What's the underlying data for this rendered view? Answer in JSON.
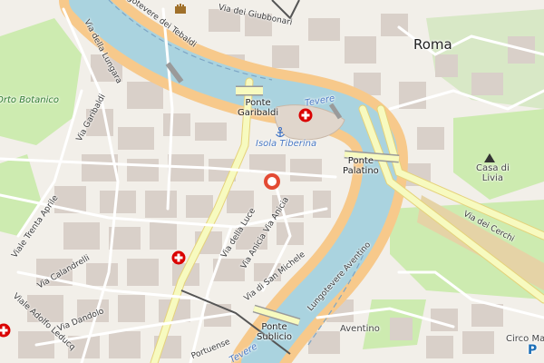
{
  "map": {
    "labels": {
      "city": "Roma",
      "river": "Tevere",
      "river_top": "Lungotevere dei Tebaldi",
      "giubbonari": "Via dei Giubbonari",
      "lungara": "Via della Lungara",
      "orto_botanico": "Orto Botanico",
      "via_garibaldi": "Via Garibaldi",
      "ponte_garibaldi": "Ponte\nGaribaldi",
      "isola_tiberina": "Isola Tiberina",
      "ponte_palatino": "Ponte\nPalatino",
      "casa_di_livia": "Casa di\nLivia",
      "via_dei_cerchi": "Via dei Cerchi",
      "viale_trenta_aprile": "Viale Trenta Aprile",
      "via_della_luce": "Via della Luce",
      "via_anicia_1": "Via Anicia",
      "via_anicia_2": "Via Anicia",
      "via_san_michele": "Via di San Michele",
      "via_calandrelli": "Via Calandrelli",
      "via_dandolo": "Via Dandolo",
      "viale_adolfo_leduc": "Viale Adolfo Leducq",
      "lungotevere_aventino": "Lungotevere Aventino",
      "ponte_sublicio": "Ponte\nSublicio",
      "aventino": "Aventino",
      "circo_massimo": "Circo Massimo",
      "portuense": "Portuense",
      "circo_letter": "P",
      "tevere_small": "Tevere"
    },
    "icons": {
      "castle": "castle-icon",
      "hospital_isola": "hospital-icon",
      "hospital_trastevere": "hospital-icon",
      "hospital_left": "hospital-icon",
      "anchor": "anchor-icon",
      "marker": "location-marker-icon",
      "monument": "monument-icon"
    },
    "colors": {
      "land": "#f2efe9",
      "water": "#aad3df",
      "river_bank": "#f7c98b",
      "major_road": "#f7fabf",
      "park": "#cdebb0",
      "building": "#d9d0c9",
      "marker": "#e34a33",
      "hospital": "#da0000",
      "rail": "#555555"
    }
  }
}
